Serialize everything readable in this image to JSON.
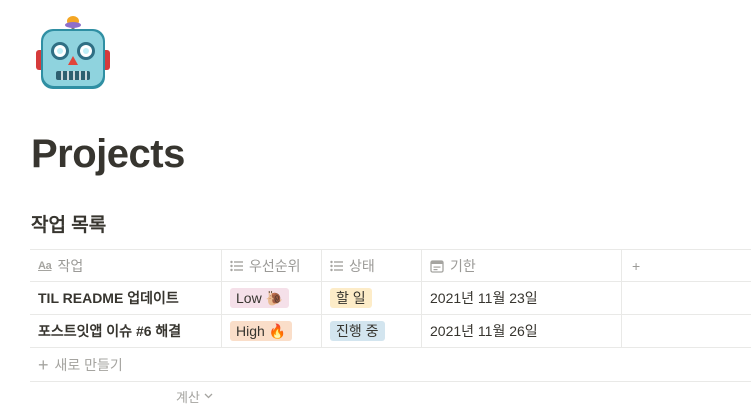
{
  "page": {
    "icon": "robot-face-icon",
    "title": "Projects"
  },
  "database": {
    "title": "작업 목록",
    "columns": [
      {
        "label": "작업",
        "icon": "text-aa-icon"
      },
      {
        "label": "우선순위",
        "icon": "list-icon"
      },
      {
        "label": "상태",
        "icon": "list-icon"
      },
      {
        "label": "기한",
        "icon": "calendar-icon"
      },
      {
        "label": "+",
        "icon": "plus-icon"
      }
    ],
    "rows": [
      {
        "task": "TIL README 업데이트",
        "priority": "Low 🐌",
        "priority_color": "#f5e0e9",
        "status": "할 일",
        "status_color": "#fdecc8",
        "due": "2021년 11월 23일"
      },
      {
        "task": "포스트잇앱 이슈 #6 해결",
        "priority": "High 🔥",
        "priority_color": "#fadec9",
        "status": "진행 중",
        "status_color": "#d3e5ef",
        "due": "2021년 11월 26일"
      }
    ],
    "new_row_label": "새로 만들기",
    "calculate_label": "계산"
  },
  "colors": {
    "text": "#37352f",
    "muted": "#9b9a97",
    "border": "#e9e9e7"
  }
}
